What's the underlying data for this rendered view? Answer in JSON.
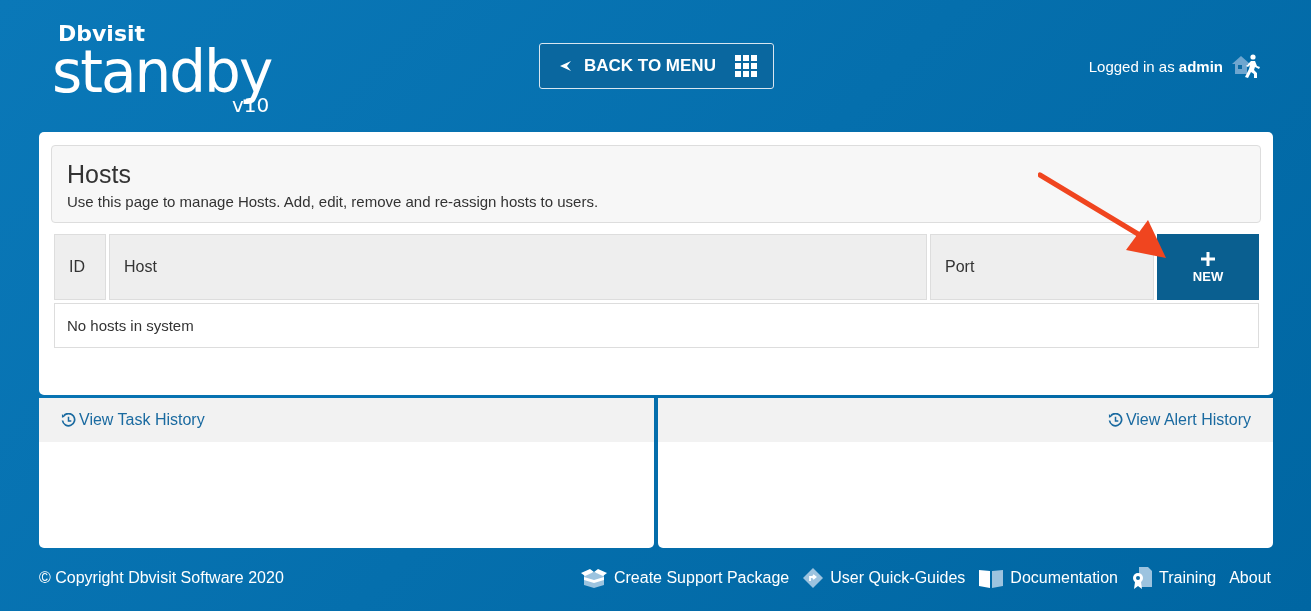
{
  "logo": {
    "brand": "Dbvisit",
    "product": "standby",
    "version": "v10"
  },
  "back_button": {
    "label": "BACK TO MENU"
  },
  "user": {
    "prefix": "Logged in as",
    "name": "admin"
  },
  "page": {
    "title": "Hosts",
    "description": "Use this page to manage Hosts. Add, edit, remove and re-assign hosts to users."
  },
  "table": {
    "columns": [
      "ID",
      "Host",
      "Port"
    ],
    "new_button": "NEW",
    "empty_message": "No hosts in system"
  },
  "panels": [
    {
      "link": "View Task History",
      "kind": "task"
    },
    {
      "link": "View Alert History",
      "kind": "alert"
    }
  ],
  "footer": {
    "copyright": "© Copyright Dbvisit Software 2020",
    "links": [
      {
        "kind": "support",
        "label": "Create Support Package"
      },
      {
        "kind": "guides",
        "label": "User Quick-Guides"
      },
      {
        "kind": "docs",
        "label": "Documentation"
      },
      {
        "kind": "training",
        "label": "Training"
      },
      {
        "kind": "plain",
        "label": "About"
      }
    ]
  }
}
